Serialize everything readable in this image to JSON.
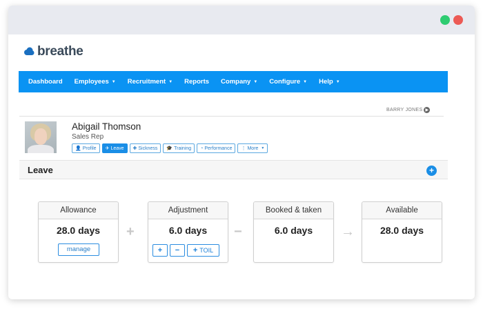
{
  "app": {
    "logo_text": "breathe",
    "brand_color": "#0a93f3"
  },
  "window_controls": [
    "green-dot",
    "red-dot"
  ],
  "nav": {
    "items": [
      {
        "label": "Dashboard",
        "dropdown": false
      },
      {
        "label": "Employees",
        "dropdown": true
      },
      {
        "label": "Recruitment",
        "dropdown": true
      },
      {
        "label": "Reports",
        "dropdown": false
      },
      {
        "label": "Company",
        "dropdown": true
      },
      {
        "label": "Configure",
        "dropdown": true
      },
      {
        "label": "Help",
        "dropdown": true
      }
    ]
  },
  "user_link": {
    "label": "BARRY JONES"
  },
  "employee": {
    "name": "Abigail Thomson",
    "role": "Sales Rep",
    "tabs": [
      {
        "label": "Profile",
        "icon": "person-icon",
        "active": false
      },
      {
        "label": "Leave",
        "icon": "plane-icon",
        "active": true
      },
      {
        "label": "Sickness",
        "icon": "medkit-icon",
        "active": false
      },
      {
        "label": "Training",
        "icon": "graduation-cap-icon",
        "active": false
      },
      {
        "label": "Performance",
        "icon": "gauge-icon",
        "active": false
      },
      {
        "label": "More",
        "icon": "vertical-ellipsis-icon",
        "active": false
      }
    ]
  },
  "leave": {
    "title": "Leave",
    "cards": {
      "allowance": {
        "label": "Allowance",
        "value": "28.0 days",
        "button": "manage"
      },
      "adjustment": {
        "label": "Adjustment",
        "value": "6.0 days",
        "toil_label": "TOIL"
      },
      "booked": {
        "label": "Booked & taken",
        "value": "6.0 days"
      },
      "available": {
        "label": "Available",
        "value": "28.0 days"
      }
    },
    "operators": [
      "+",
      "−",
      "→"
    ]
  }
}
